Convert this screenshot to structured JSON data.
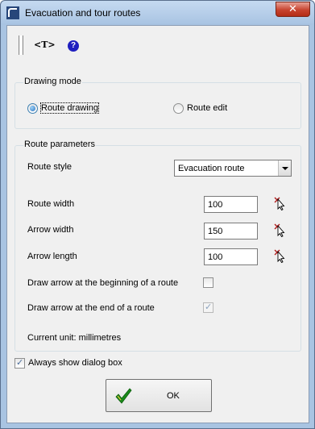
{
  "window": {
    "title": "Evacuation and tour routes",
    "close_glyph": "✕"
  },
  "toolbar": {
    "text_tool_label": "<T>",
    "help_glyph": "?"
  },
  "drawing_mode": {
    "caption": "Drawing mode",
    "options": [
      {
        "label": "Route drawing",
        "selected": true
      },
      {
        "label": "Route edit",
        "selected": false
      }
    ]
  },
  "route_parameters": {
    "caption": "Route parameters",
    "route_style": {
      "label": "Route style",
      "value": "Evacuation route"
    },
    "route_width": {
      "label": "Route width",
      "value": "100"
    },
    "arrow_width": {
      "label": "Arrow width",
      "value": "150"
    },
    "arrow_length": {
      "label": "Arrow length",
      "value": "100"
    },
    "arrow_begin": {
      "label": "Draw arrow at the beginning of a route",
      "checked": false
    },
    "arrow_end": {
      "label": "Draw arrow at the end of a route",
      "checked": true,
      "disabled": true
    },
    "current_unit": "Current unit: millimetres"
  },
  "always_show": {
    "label": "Always show dialog box",
    "checked": true
  },
  "ok_button": {
    "label": "OK"
  },
  "colors": {
    "title_bar": "#a9c4e2",
    "close_button": "#c7432f",
    "help_icon": "#1f1fbf",
    "ok_check": "#1a8a1a"
  }
}
